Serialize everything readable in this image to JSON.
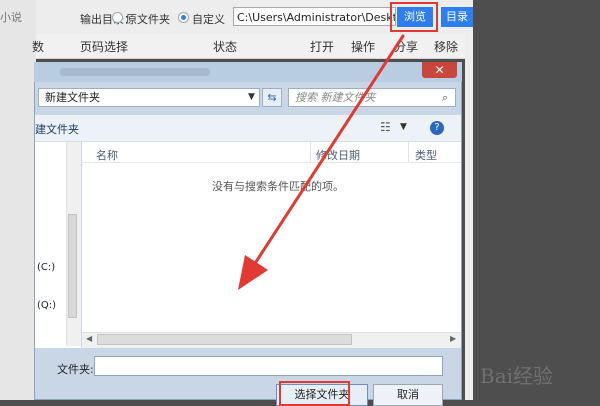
{
  "background_app": {
    "edge_text": "小说",
    "output_label": "输出目录：",
    "radio_options": [
      {
        "label": "原文件夹",
        "checked": false
      },
      {
        "label": "自定义",
        "checked": true
      }
    ],
    "path_value": "C:\\Users\\Administrator\\Desktop",
    "browse_label": "浏览",
    "dir_label": "目录",
    "columns": [
      "数",
      "页码选择",
      "状态",
      "打开",
      "操作",
      "分享",
      "移除"
    ]
  },
  "dialog": {
    "address": "新建文件夹",
    "search_placeholder": "搜索 新建文件夹",
    "toolbar_label": "建文件夹",
    "drives": [
      "(C:)",
      "(Q:)"
    ],
    "file_columns": [
      "名称",
      "修改日期",
      "类型"
    ],
    "empty_message": "没有与搜索条件匹配的项。",
    "folder_label": "文件夹:",
    "folder_value": "",
    "select_button": "选择文件夹",
    "cancel_button": "取消",
    "close_symbol": "✕"
  },
  "annotation": {
    "color": "#e03a32"
  },
  "colors": {
    "accent": "#2d7ff0",
    "highlight": "#e03a32"
  },
  "icons": [
    "refresh-icon",
    "search-icon",
    "view-options-icon",
    "help-icon",
    "close-icon"
  ]
}
